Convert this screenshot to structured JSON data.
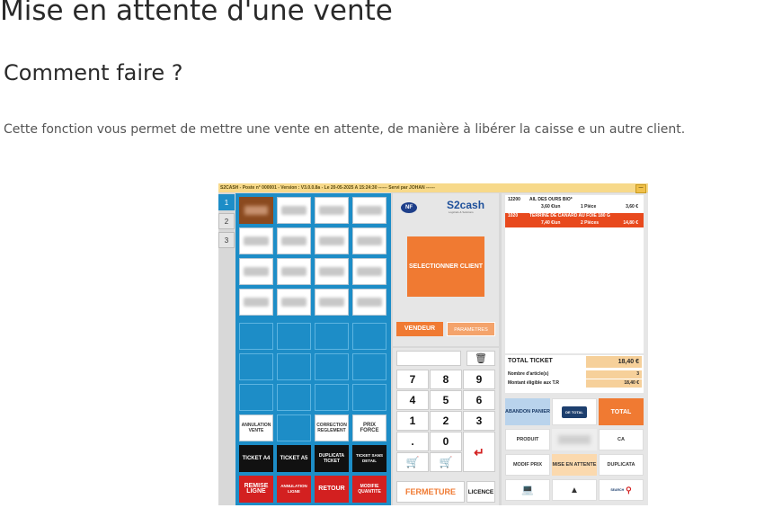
{
  "page": {
    "title": "Mise en attente d'une vente",
    "subtitle": "Comment faire ?",
    "paragraph": "Cette fonction vous permet de mettre une vente en attente, de manière à libérer la caisse e un autre client."
  },
  "screenshot": {
    "titlebar": "S2CASH - Poste n° 000001 - Version : V3.0.0.8a - Le 20-05-2025 A 15:24:30 ------ Servi par JOHAN ------",
    "titlebar_button": "—",
    "tabs": [
      "1",
      "2",
      "3"
    ],
    "grid_bottom": {
      "annulation_vente": "ANNULATION VENTE",
      "correction_reglement": "CORRECTION REGLEMENT",
      "prix_force": "PRIX FORCE",
      "ticket_a4": "TICKET A4",
      "ticket_a5": "TICKET A5",
      "duplicata_ticket": "DUPLICATA TICKET",
      "ticket_sans_detail": "TICKET SANS DETAIL",
      "remise_ligne": "REMISE LIGNE",
      "annulation_ligne": "ANNULATION LIGNE",
      "retour": "RETOUR",
      "modifie_quantite": "MODIFIE QUANTITE"
    },
    "middle": {
      "nf_logo": "NF",
      "brand": "S2cash",
      "brand_sub": "Logiciels & Solutions",
      "selectionner_client": "SELECTIONNER CLIENT",
      "vendeur": "VENDEUR",
      "parametres": "PARAMETRES",
      "keys": [
        "7",
        "8",
        "9",
        "4",
        "5",
        "6",
        "1",
        "2",
        "3",
        ".",
        "0"
      ],
      "fermeture": "FERMETURE",
      "licence": "LICENCE",
      "trash_icon": "trash-icon",
      "cart_icon": "cart-icon",
      "enter_icon": "enter-arrow-icon"
    },
    "ticket": {
      "line1": {
        "code": "12200",
        "name": "AIL DES OURS BIO*",
        "unit": "3,60 €/un",
        "qty": "1 Pièce",
        "amount": "3,60 €"
      },
      "line2": {
        "code": "1020",
        "name": "TERRINE DE CANARD AU FOIE 180 G",
        "unit": "7,40 €/un",
        "qty": "2 Pièces",
        "amount": "14,80 €"
      }
    },
    "totals": {
      "total_ticket_label": "TOTAL TICKET",
      "total_ticket_value": "18,40 €",
      "nb_articles_label": "Nombre d'article(s)",
      "nb_articles_value": "3",
      "montant_tr_label": "Montant éligible aux T.R",
      "montant_tr_value": "18,40 €"
    },
    "right_buttons": {
      "abandon_panier": "ABANDON PANIER",
      "de_total": "DE TOTAL",
      "total": "TOTAL",
      "produit": "PRODUIT",
      "ca": "CA",
      "modif_prix": "MODIF PRIX",
      "mise_en_attente": "MISE EN ATTENTE",
      "duplicata": "DUPLICATA",
      "search_label": "SEARCH"
    },
    "colors": {
      "accent_blue": "#1d8dc7",
      "accent_orange": "#f07a32",
      "selected_line": "#e8491d"
    }
  }
}
